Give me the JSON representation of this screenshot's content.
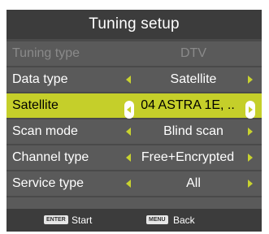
{
  "title": "Tuning setup",
  "rows": [
    {
      "label": "Tuning type",
      "value": "DTV",
      "state": "disabled"
    },
    {
      "label": "Data type",
      "value": "Satellite",
      "state": "normal"
    },
    {
      "label": "Satellite",
      "value": "04 ASTRA 1E, ..",
      "state": "selected"
    },
    {
      "label": "Scan mode",
      "value": "Blind scan",
      "state": "normal"
    },
    {
      "label": "Channel type",
      "value": "Free+Encrypted",
      "state": "normal"
    },
    {
      "label": "Service type",
      "value": "All",
      "state": "normal"
    }
  ],
  "footer": {
    "enter_key": "ENTER",
    "enter_label": "Start",
    "menu_key": "MENU",
    "menu_label": "Back"
  },
  "colors": {
    "panel": "#4a4a4a",
    "row": "#5a5a5a",
    "header": "#3c3c3c",
    "highlight": "#c5cf2a",
    "arrow": "#c8d22f"
  },
  "icons": {
    "left": "left-arrow-icon",
    "right": "right-arrow-icon"
  }
}
